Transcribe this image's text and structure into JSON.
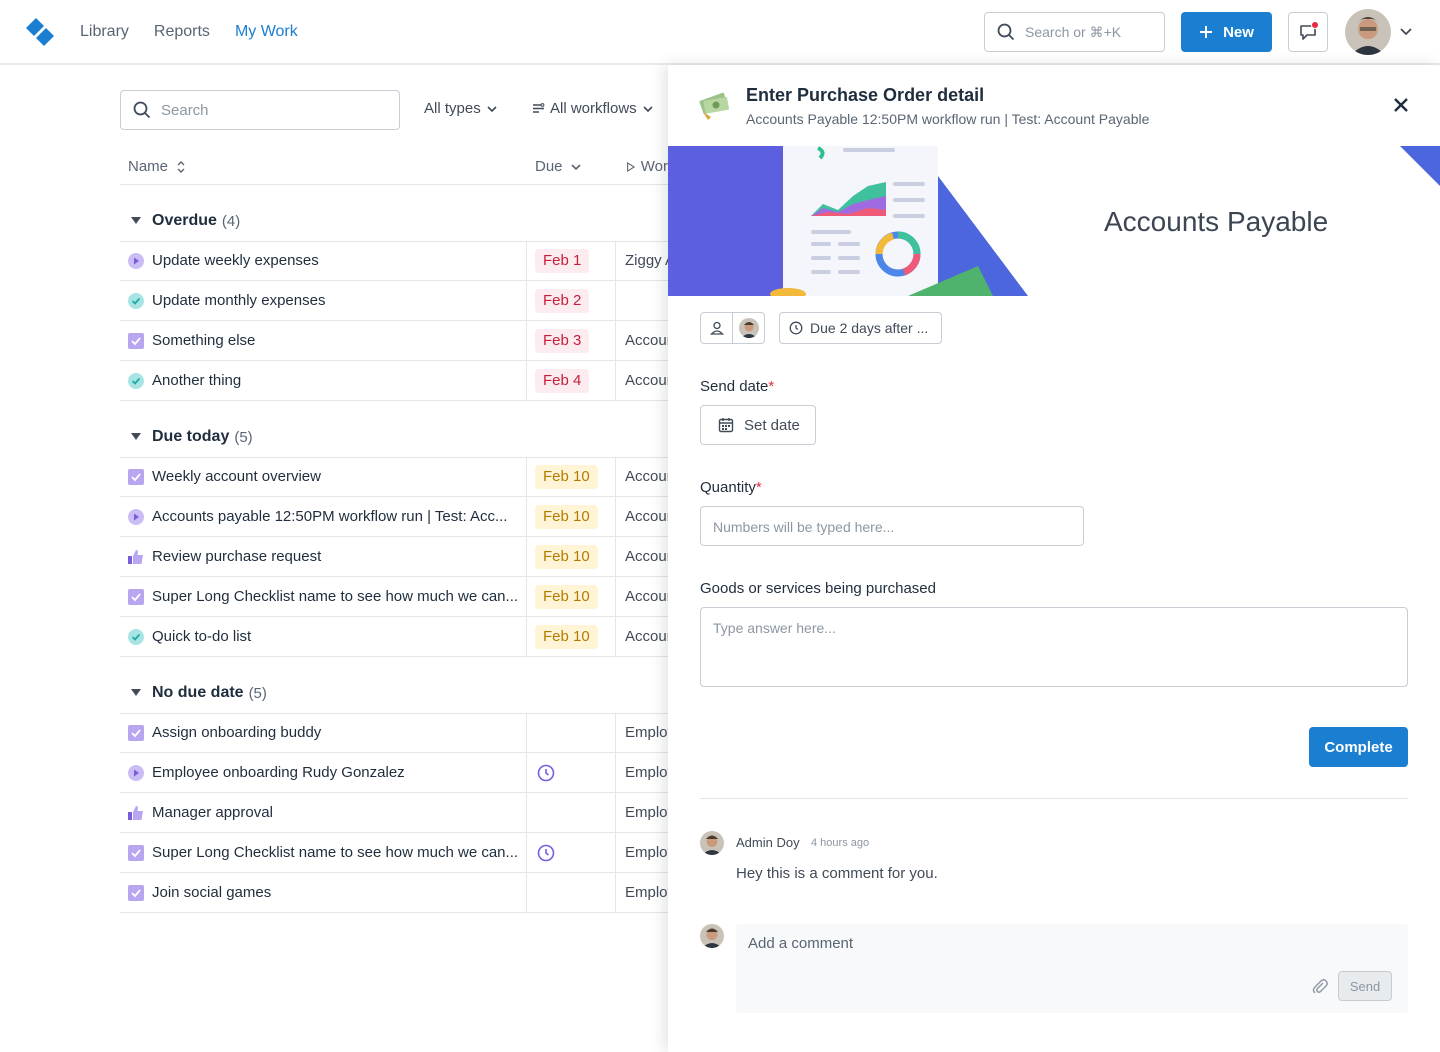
{
  "nav": {
    "items": [
      "Library",
      "Reports",
      "My Work"
    ],
    "active": "My Work"
  },
  "top": {
    "search_placeholder": "Search or ⌘+K",
    "new_label": "New"
  },
  "list": {
    "search_placeholder": "Search",
    "filter_types": "All types",
    "filter_workflows": "All workflows",
    "col_name": "Name",
    "col_due": "Due",
    "col_workflow": "Wor",
    "groups": [
      {
        "name": "Overdue",
        "count": "(4)"
      },
      {
        "name": "Due today",
        "count": "(5)"
      },
      {
        "name": "No due date",
        "count": "(5)"
      }
    ],
    "rows": [
      {
        "name": "Update weekly expenses",
        "due": "Feb 1",
        "workflow": "Ziggy A"
      },
      {
        "name": "Update monthly expenses",
        "due": "Feb 2",
        "workflow": ""
      },
      {
        "name": "Something else",
        "due": "Feb 3",
        "workflow": "Account"
      },
      {
        "name": "Another thing",
        "due": "Feb 4",
        "workflow": "Account"
      },
      {
        "name": "Weekly account overview",
        "due": "Feb 10",
        "workflow": "Account"
      },
      {
        "name": "Accounts payable 12:50PM workflow run | Test: Acc...",
        "due": "Feb 10",
        "workflow": "Account"
      },
      {
        "name": "Review purchase request",
        "due": "Feb 10",
        "workflow": "Account"
      },
      {
        "name": "Super Long Checklist name to see how much we can...",
        "due": "Feb 10",
        "workflow": "Account"
      },
      {
        "name": "Quick to-do list",
        "due": "Feb 10",
        "workflow": "Account"
      },
      {
        "name": "Assign onboarding buddy",
        "due": "",
        "workflow": "Employ"
      },
      {
        "name": "Employee onboarding Rudy Gonzalez",
        "due": "",
        "workflow": "Employ"
      },
      {
        "name": "Manager approval",
        "due": "",
        "workflow": "Employ"
      },
      {
        "name": "Super Long Checklist name to see how much we can...",
        "due": "",
        "workflow": "Employ"
      },
      {
        "name": "Join social games",
        "due": "",
        "workflow": "Employ"
      }
    ]
  },
  "drawer": {
    "title": "Enter Purchase Order detail",
    "subtitle": "Accounts Payable 12:50PM workflow run | Test: Account Payable",
    "banner_title": "Accounts Payable",
    "due_chip": "Due 2 days after ...",
    "send_date_label": "Send date",
    "required_mark": "*",
    "set_date": "Set date",
    "quantity_label": "Quantity",
    "quantity_placeholder": "Numbers will be typed here...",
    "goods_label": "Goods or services being purchased",
    "goods_placeholder": "Type answer here...",
    "complete": "Complete",
    "comment": {
      "author": "Admin Doy",
      "time": "4 hours ago",
      "text": "Hey this is a comment for you."
    },
    "comment_placeholder": "Add a comment",
    "send": "Send"
  },
  "colors": {
    "primary": "#1b7fd1",
    "overdue_bg": "#fdecef",
    "overdue_text": "#c41f3a",
    "today_bg": "#fff5d6",
    "today_text": "#b57a00",
    "task_purple": "#8b6fe0",
    "task_teal": "#3cc2c2"
  },
  "icons": [
    "logo-icon",
    "search-icon",
    "plus-icon",
    "chat-icon",
    "chevron-down-icon",
    "sort-icon",
    "play-outline-icon",
    "close-icon",
    "user-icon",
    "clock-icon",
    "calendar-icon",
    "paperclip-icon",
    "caret-down-icon",
    "checkbox-icon",
    "check-circle-icon",
    "play-circle-icon",
    "thumbs-up-icon"
  ]
}
